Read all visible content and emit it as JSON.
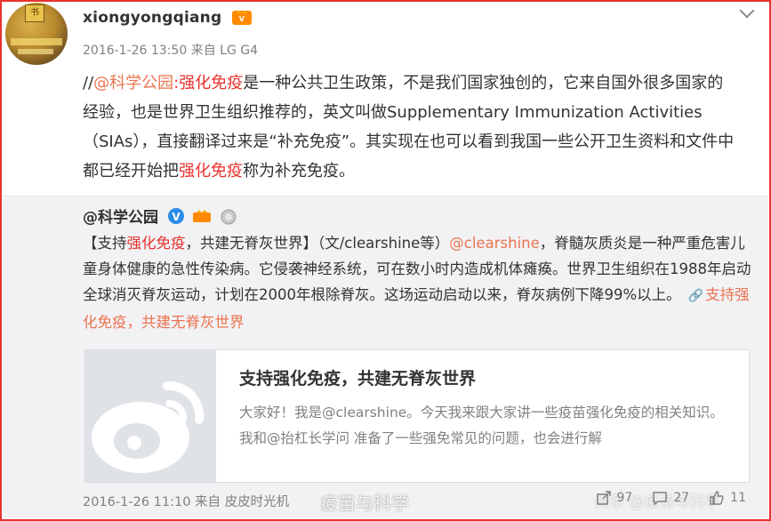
{
  "post": {
    "username": "xiongyongqiang",
    "badge_text": "V",
    "meta": "2016-1-26 13:50 来自 LG G4",
    "content": {
      "prefix": "//",
      "mention": "@科学公园",
      "colon": ":",
      "hl1": "强化免疫",
      "text1": "是一种公共卫生政策，不是我们国家独创的，它来自国外很多国家的经验，也是世界卫生组织推荐的，英文叫做Supplementary Immunization Activities（SIAs），直接翻译过来是“补充免疫”。其实现在也可以看到我国一些公开卫生资料和文件中都已经开始把",
      "hl2": "强化免疫",
      "text2": "称为补充免疫。"
    }
  },
  "repost": {
    "username": "@科学公园",
    "text_parts": {
      "p1": "【支持",
      "hl": "强化免疫",
      "p2": "，共建无脊灰世界】（文/clearshine等）",
      "mention": "@clearshine",
      "p3": "，脊髓灰质炎是一种严重危害儿童身体健康的急性传染病。它侵袭神经系统，可在数小时内造成机体瘫痪。世界卫生组织在1988年启动全球消灭脊灰运动，计划在2000年根除脊灰。这场运动启动以来，脊灰病例下降99%以上。",
      "link": "支持强化免疫，共建无脊灰世界"
    },
    "card": {
      "title": "支持强化免疫，共建无脊灰世界",
      "desc": "大家好！我是@clearshine。今天我来跟大家讲一些疫苗强化免疫的相关知识。我和@抬杠长学问 准备了一些强免常见的问题，也会进行解"
    },
    "footer": {
      "time": "2016-1-26 11:10 来自 皮皮时光机",
      "share_count": "97",
      "comment_count": "27",
      "like_count": "11"
    }
  },
  "watermark": "疫苗与科学",
  "watermark2": "头条 @疫苗与科学"
}
